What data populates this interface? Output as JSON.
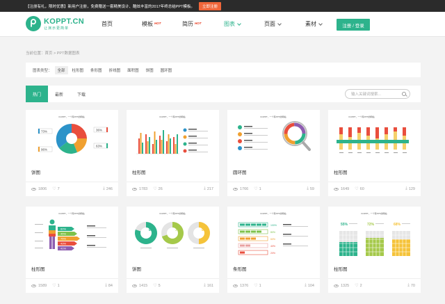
{
  "promo": {
    "text": "【注册有礼，限时优惠】新用户注册，免费赠送一套精美设计、酷炫丰富的2017年终总结PPT模板。",
    "cta": "立即注册"
  },
  "logo": {
    "name": "KOPPT.CN",
    "tagline": "让演示更简单"
  },
  "nav": {
    "items": [
      {
        "label": "首页"
      },
      {
        "label": "模板",
        "badge": "HOT"
      },
      {
        "label": "简历",
        "badge": "HOT"
      },
      {
        "label": "图表"
      },
      {
        "label": "页面"
      },
      {
        "label": "素材"
      }
    ],
    "register": "注册 / 登录"
  },
  "breadcrumb": "当前位置：首页 > PPT数据图表",
  "filter": {
    "label": "图表类型：",
    "options": [
      "全部",
      "柱形图",
      "条形图",
      "折线图",
      "面积图",
      "饼图",
      "圆环图"
    ]
  },
  "tabs": [
    "热门",
    "最新",
    "下载"
  ],
  "search": {
    "placeholder": "输入关键词搜索..."
  },
  "cards": [
    {
      "title": "饼图",
      "views": "1806",
      "likes": "7",
      "downloads": "246"
    },
    {
      "title": "柱形图",
      "views": "1783",
      "likes": "26",
      "downloads": "217"
    },
    {
      "title": "圆环图",
      "views": "1766",
      "likes": "1",
      "downloads": "59"
    },
    {
      "title": "柱形图",
      "views": "1649",
      "likes": "60",
      "downloads": "129"
    },
    {
      "title": "柱形图",
      "views": "1589",
      "likes": "1",
      "downloads": "84"
    },
    {
      "title": "饼图",
      "views": "1415",
      "likes": "5",
      "downloads": "161"
    },
    {
      "title": "条形图",
      "views": "1376",
      "likes": "1",
      "downloads": "104"
    },
    {
      "title": "柱形图",
      "views": "1325",
      "likes": "2",
      "downloads": "70"
    }
  ],
  "thumbs": {
    "heading": "KOPPT，一个有PPT的网站",
    "t1": {
      "p1": "73%",
      "p2": "96%",
      "p3": "36%",
      "p4": "63%"
    },
    "t5": {
      "p1": "60%",
      "p2": "45%",
      "p3": "75%",
      "p4": "43%",
      "p5": "41%"
    },
    "t6": {
      "p1": "80%",
      "p2": "70%",
      "p3": "50%"
    },
    "t7": {
      "p1": "100%",
      "p2": "80%",
      "p3": "60%",
      "p4": "40%",
      "p5": "20%"
    },
    "t8": {
      "p1": "55%",
      "p2": "72%",
      "p3": "68%"
    }
  },
  "colors": {
    "brand": "#2db38c",
    "cta": "#f0663a",
    "hot": "#e8391d"
  }
}
